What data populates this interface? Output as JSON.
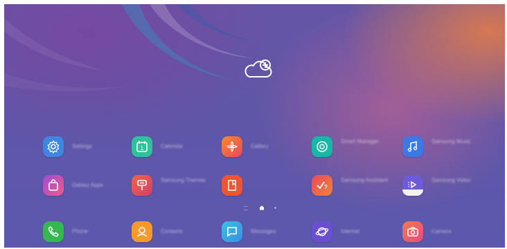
{
  "home_screen": {
    "apps": [
      {
        "label": "Settings",
        "icon": "settings-icon",
        "color": "#3f86e0"
      },
      {
        "label": "Calendar",
        "icon": "calendar-icon",
        "color": "#2fc29a",
        "badge": "1"
      },
      {
        "label": "Gallery",
        "icon": "gallery-icon",
        "color": "#f0683e"
      },
      {
        "label": "Smart Manager",
        "icon": "smart-manager-icon",
        "color": "#17b8a6"
      },
      {
        "label": "Samsung Music",
        "icon": "music-icon",
        "color": "#3c78e6"
      },
      {
        "label": "Galaxy Apps",
        "icon": "shopping-bag-icon",
        "color": "#d24aa8"
      },
      {
        "label": "Samsung Themes",
        "icon": "themes-icon",
        "color": "#e5484a"
      },
      {
        "label": "",
        "icon": "notes-icon",
        "color": "#ee5332"
      },
      {
        "label": "Samsung Assistant",
        "icon": "assistant-icon",
        "color": "#ec4d6b"
      },
      {
        "label": "Samsung Video",
        "icon": "video-icon",
        "color": "#7a64d6"
      },
      {
        "label": "Phone",
        "icon": "phone-icon",
        "color": "#35b84f"
      },
      {
        "label": "Contacts",
        "icon": "contacts-icon",
        "color": "#f39a2a"
      },
      {
        "label": "Messages",
        "icon": "messages-icon",
        "color": "#2cb3e8"
      },
      {
        "label": "Internet",
        "icon": "internet-icon",
        "color": "#6a4fd0"
      },
      {
        "label": "Camera",
        "icon": "camera-icon",
        "color": "#ee5a7e"
      }
    ],
    "pager": {
      "pages": 3,
      "current": 2
    }
  }
}
